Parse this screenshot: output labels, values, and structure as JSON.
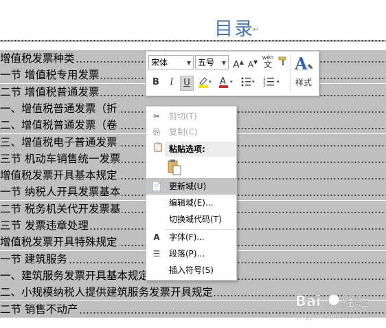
{
  "document": {
    "title": "目录",
    "paragraph_mark": "↵"
  },
  "toc": [
    {
      "text": " 增值税发票种类",
      "highlighted": true
    },
    {
      "text": "一节 增值税专用发票",
      "highlighted": true
    },
    {
      "text": "二节 增值税普通发票",
      "highlighted": true
    },
    {
      "text": "    一、增值税普通发票（折",
      "highlighted": true
    },
    {
      "text": "    二、增值税普通发票（卷",
      "highlighted": true
    },
    {
      "text": "    三、增值税电子普通发票",
      "highlighted": true
    },
    {
      "text": "三节 机动车销售统一发票",
      "highlighted": true
    },
    {
      "text": " 增值税发票开具基本规定",
      "highlighted": true
    },
    {
      "text": "一节 纳税人开具发票基本",
      "highlighted": true
    },
    {
      "text": "二节 税务机关代开发票基",
      "highlighted": true
    },
    {
      "text": "三节 发票违章处理",
      "highlighted": true
    },
    {
      "text": " 增值税发票开具特殊规定",
      "highlighted": true
    },
    {
      "text": "一节 建筑服务",
      "highlighted": true
    },
    {
      "text": "    一、建筑服务发票开具基本规定",
      "highlighted": true
    },
    {
      "text": "    二、小规模纳税人提供建筑服务发票开具规定",
      "highlighted": true
    },
    {
      "text": "二节 销售不动产",
      "highlighted": true
    }
  ],
  "mini_toolbar": {
    "font_name": "宋体",
    "font_size": "五号",
    "grow_font": "A",
    "shrink_font": "A",
    "phonetic": "wén",
    "bold": "B",
    "italic": "I",
    "underline": "U",
    "font_color": "A",
    "styles_label": "样式",
    "accent_red": "#d22c2c",
    "accent_yellow": "#f6e21b"
  },
  "context_menu": {
    "cut": "剪切(T)",
    "copy": "复制(C)",
    "paste_options": "粘贴选项:",
    "update_field": "更新域(U)",
    "edit_field": "编辑域(E)...",
    "toggle_field_codes": "切换域代码(T)",
    "font": "字体(F)...",
    "paragraph": "段落(P)...",
    "insert_symbol": "插入符号(S)"
  }
}
